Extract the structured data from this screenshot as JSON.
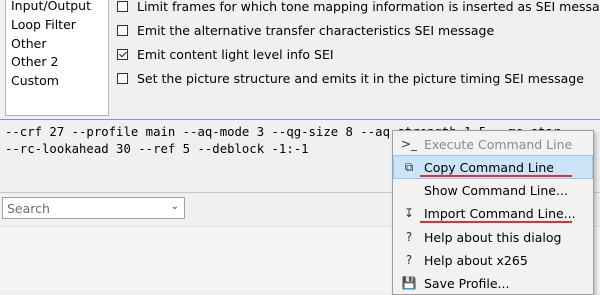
{
  "categories": [
    "Input/Output",
    "Loop Filter",
    "Other",
    "Other 2",
    "Custom"
  ],
  "options": [
    {
      "label": "Limit frames for which tone mapping information is inserted as SEI message",
      "checked": false
    },
    {
      "label": "Emit the alternative transfer characteristics SEI message",
      "checked": false
    },
    {
      "label": "Emit content light level info SEI",
      "checked": true
    },
    {
      "label": "Set the picture structure and emits it in the picture timing SEI message",
      "checked": false
    }
  ],
  "command_line": {
    "line1": "--crf 27 --profile main --aq-mode 3 --qg-size 8 --aq-strength 1.5 --me star",
    "line2": "--rc-lookahead 30 --ref 5 --deblock -1:-1"
  },
  "search": {
    "placeholder": "Search"
  },
  "context_menu": {
    "items": [
      {
        "label": "Execute Command Line",
        "icon": "execute-icon",
        "disabled": true
      },
      {
        "label": "Copy Command Line",
        "icon": "copy-icon",
        "highlighted": true
      },
      {
        "label": "Show Command Line...",
        "icon": ""
      },
      {
        "label": "Import Command Line...",
        "icon": "import-icon"
      },
      {
        "label": "Help about this dialog",
        "icon": "help-icon"
      },
      {
        "label": "Help about x265",
        "icon": "help-icon"
      },
      {
        "label": "Save Profile...",
        "icon": "save-icon"
      }
    ],
    "annotation_color": "#e03030",
    "highlight_color": "#cce4f7"
  }
}
